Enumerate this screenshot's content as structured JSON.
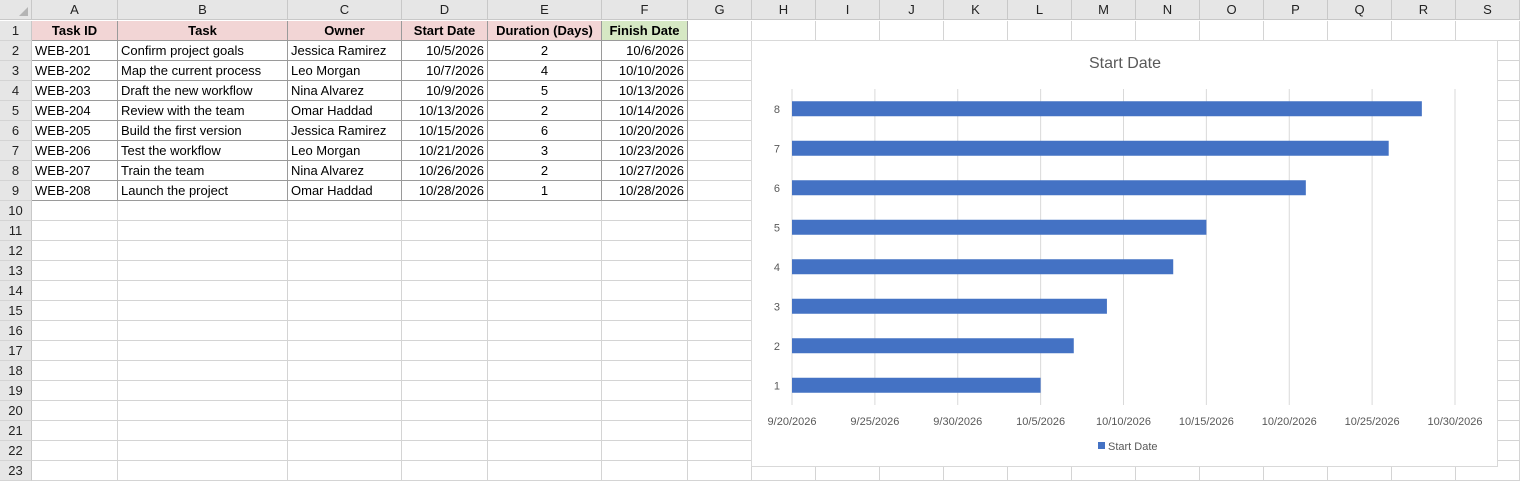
{
  "columns": [
    "A",
    "B",
    "C",
    "D",
    "E",
    "F",
    "G",
    "H",
    "I",
    "J",
    "K",
    "L",
    "M",
    "N",
    "O",
    "P",
    "Q",
    "R",
    "S"
  ],
  "rows": [
    "1",
    "2",
    "3",
    "4",
    "5",
    "6",
    "7",
    "8",
    "9",
    "10",
    "11",
    "12",
    "13",
    "14",
    "15",
    "16",
    "17",
    "18",
    "19",
    "20",
    "21",
    "22",
    "23"
  ],
  "table": {
    "headers": [
      "Task ID",
      "Task",
      "Owner",
      "Start Date",
      "Duration (Days)",
      "Finish Date"
    ],
    "rows": [
      [
        "WEB-201",
        "Confirm project goals",
        "Jessica Ramirez",
        "10/5/2026",
        "2",
        "10/6/2026"
      ],
      [
        "WEB-202",
        "Map the current process",
        "Leo Morgan",
        "10/7/2026",
        "4",
        "10/10/2026"
      ],
      [
        "WEB-203",
        "Draft the new workflow",
        "Nina Alvarez",
        "10/9/2026",
        "5",
        "10/13/2026"
      ],
      [
        "WEB-204",
        "Review with the team",
        "Omar Haddad",
        "10/13/2026",
        "2",
        "10/14/2026"
      ],
      [
        "WEB-205",
        "Build the first version",
        "Jessica Ramirez",
        "10/15/2026",
        "6",
        "10/20/2026"
      ],
      [
        "WEB-206",
        "Test the workflow",
        "Leo Morgan",
        "10/21/2026",
        "3",
        "10/23/2026"
      ],
      [
        "WEB-207",
        "Train the team",
        "Nina Alvarez",
        "10/26/2026",
        "2",
        "10/27/2026"
      ],
      [
        "WEB-208",
        "Launch the project",
        "Omar Haddad",
        "10/28/2026",
        "1",
        "10/28/2026"
      ]
    ]
  },
  "colors": {
    "header_pink": "#f2d5d5",
    "header_green": "#d6e8c4",
    "bar": "#4472c4",
    "gridline": "#d9d9d9",
    "axis_text": "#595959"
  },
  "chart_data": {
    "type": "bar",
    "orientation": "horizontal",
    "title": "Start Date",
    "categories": [
      "1",
      "2",
      "3",
      "4",
      "5",
      "6",
      "7",
      "8"
    ],
    "series": [
      {
        "name": "Start Date",
        "values": [
          "10/5/2026",
          "10/7/2026",
          "10/9/2026",
          "10/13/2026",
          "10/15/2026",
          "10/21/2026",
          "10/26/2026",
          "10/28/2026"
        ]
      }
    ],
    "xticks": [
      "9/20/2026",
      "9/25/2026",
      "9/30/2026",
      "10/5/2026",
      "10/10/2026",
      "10/15/2026",
      "10/20/2026",
      "10/25/2026",
      "10/30/2026"
    ],
    "xlim": [
      "9/20/2026",
      "10/30/2026"
    ],
    "grid": "vertical",
    "legend": "bottom"
  }
}
